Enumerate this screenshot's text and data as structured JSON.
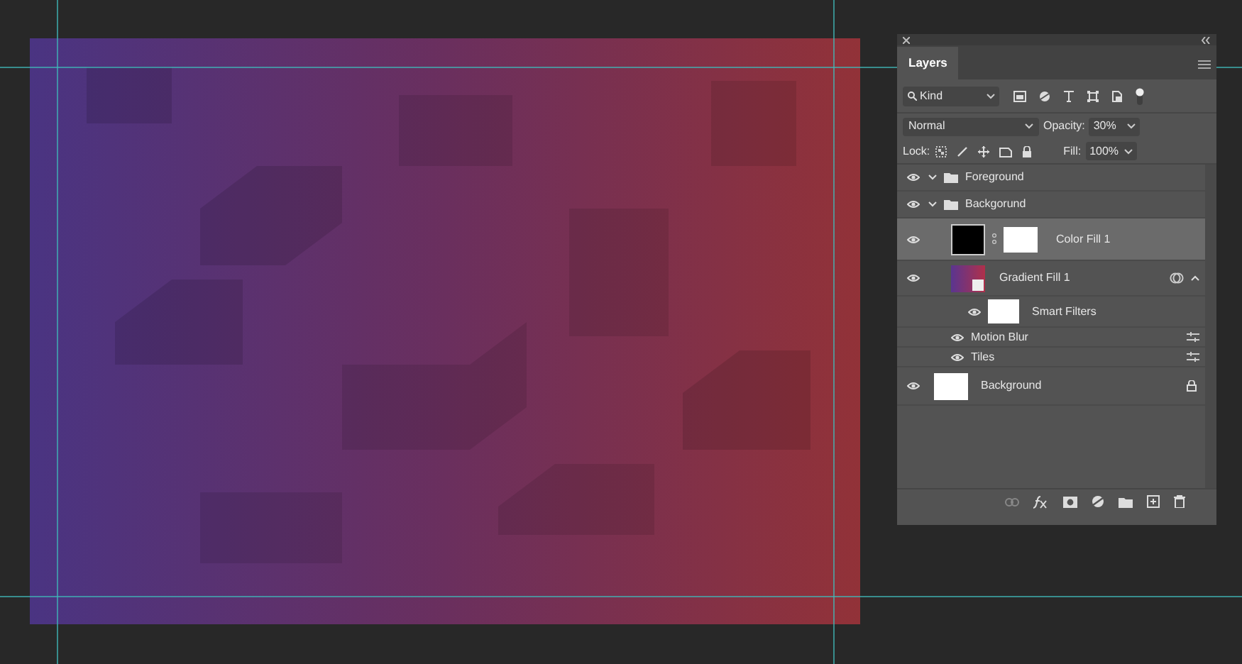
{
  "panel": {
    "title": "Layers",
    "tab_selected": true,
    "filter": {
      "value": "Kind"
    },
    "blend_mode": "Normal",
    "opacity_label": "Opacity:",
    "opacity": "30%",
    "lock_label": "Lock:",
    "fill_label": "Fill:",
    "fill": "100%",
    "layers": [
      {
        "kind": "group",
        "name": "Foreground",
        "visible": true,
        "selected": false,
        "expanded": true
      },
      {
        "kind": "group",
        "name": "Backgorund",
        "visible": true,
        "selected": false,
        "expanded": true,
        "children": [
          {
            "kind": "fill",
            "name": "Color Fill 1",
            "visible": true,
            "selected": true
          },
          {
            "kind": "smart",
            "name": "Gradient Fill 1",
            "visible": true,
            "selected": false,
            "expanded": true,
            "children": [
              {
                "kind": "filters",
                "name": "Smart Filters",
                "visible": true,
                "selected": false
              },
              {
                "kind": "filter",
                "name": "Motion Blur",
                "visible": true,
                "selected": false
              },
              {
                "kind": "filter",
                "name": "Tiles",
                "visible": true,
                "selected": false
              }
            ]
          }
        ]
      },
      {
        "kind": "background",
        "name": "Background",
        "visible": true,
        "selected": false,
        "locked": true
      }
    ]
  }
}
